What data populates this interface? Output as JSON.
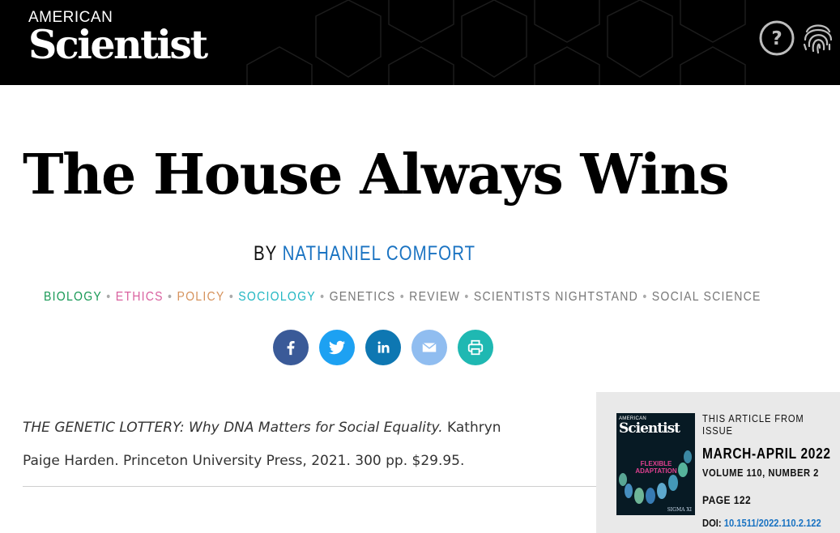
{
  "header": {
    "logo_top": "AMERICAN",
    "logo_main": "Scientist",
    "help_icon": "question-circle-icon",
    "fingerprint_icon": "fingerprint-icon"
  },
  "article": {
    "title": "The House Always Wins",
    "byline_prefix": "BY",
    "author": "NATHANIEL COMFORT"
  },
  "tags": [
    {
      "label": "BIOLOGY",
      "color": "#1a9a57"
    },
    {
      "label": "ETHICS",
      "color": "#d9619f"
    },
    {
      "label": "POLICY",
      "color": "#d6935d"
    },
    {
      "label": "SOCIOLOGY",
      "color": "#23b7c3"
    },
    {
      "label": "GENETICS",
      "color": "#777777"
    },
    {
      "label": "REVIEW",
      "color": "#777777"
    },
    {
      "label": "SCIENTISTS NIGHTSTAND",
      "color": "#777777"
    },
    {
      "label": "SOCIAL SCIENCE",
      "color": "#777777"
    }
  ],
  "share": [
    {
      "name": "facebook",
      "icon": "facebook-icon",
      "color": "#3a5a98"
    },
    {
      "name": "twitter",
      "icon": "twitter-icon",
      "color": "#1da1f2"
    },
    {
      "name": "linkedin",
      "icon": "linkedin-icon",
      "color": "#0e77b2"
    },
    {
      "name": "email",
      "icon": "envelope-icon",
      "color": "#90bdf0"
    },
    {
      "name": "print",
      "icon": "printer-icon",
      "color": "#1fb8b2"
    }
  ],
  "citation": {
    "book_title": "THE GENETIC LOTTERY: Why DNA Matters for Social Equality.",
    "details_line1": " Kathryn",
    "details_line2": "Paige Harden. Princeton University Press, 2021. 300 pp. $29.95."
  },
  "issue": {
    "label": "THIS ARTICLE FROM ISSUE",
    "name": "MARCH-APRIL 2022",
    "volume": "VOLUME 110, NUMBER 2",
    "page": "PAGE 122",
    "doi_label": "DOI:",
    "doi": "10.1511/2022.110.2.122",
    "cover": {
      "logo_top": "AMERICAN",
      "logo_main": "Scientist",
      "headline": "FLEXIBLE ADAPTATION",
      "publisher": "SIGMA XI"
    }
  }
}
